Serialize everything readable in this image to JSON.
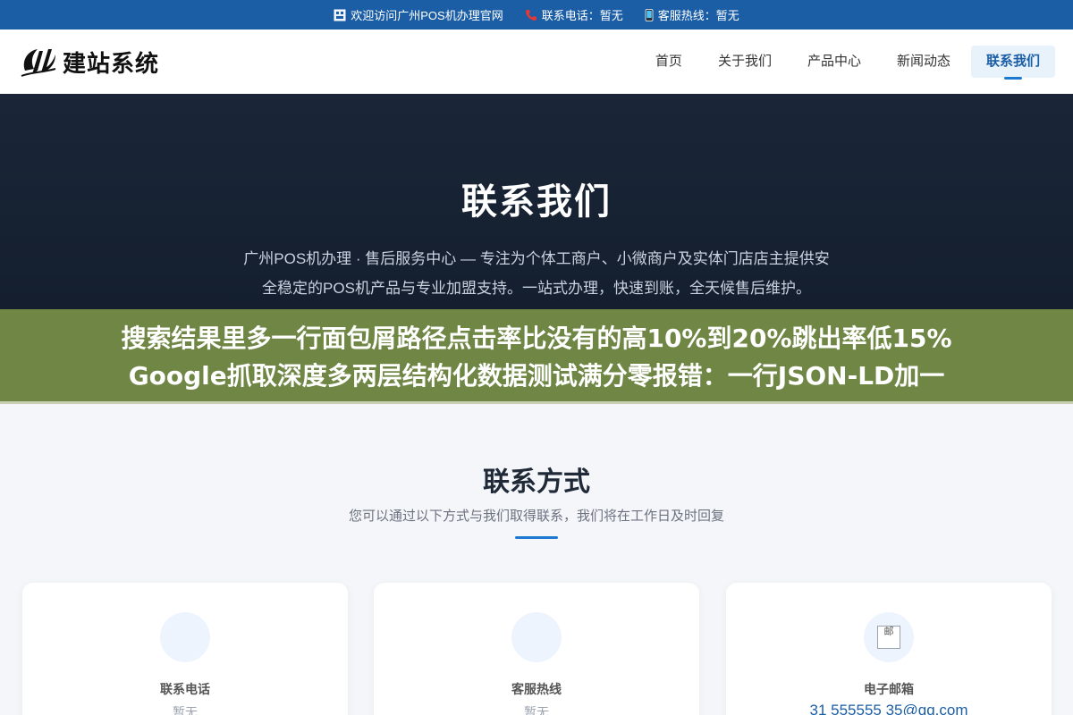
{
  "topbar": {
    "welcome": "欢迎访问广州POS机办理官网",
    "phone_label": "联系电话：暂无",
    "hotline_label": "客服热线：暂无"
  },
  "header": {
    "logo_text": "建站系统",
    "nav": [
      "首页",
      "关于我们",
      "产品中心",
      "新闻动态",
      "联系我们"
    ],
    "active_nav": "联系我们"
  },
  "hero": {
    "title": "联系我们",
    "description": "广州POS机办理 · 售后服务中心 — 专注为个体工商户、小微商户及实体门店店主提供安全稳定的POS机产品与专业加盟支持。一站式办理，快速到账，全天候售后维护。"
  },
  "banner": {
    "line1": "搜索结果里多一行面包屑路径点击率比没有的高10%到20%跳出率低15%",
    "line2": "Google抓取深度多两层结构化数据测试满分零报错：一行JSON-LD加一"
  },
  "contact": {
    "title": "联系方式",
    "subtitle": "您可以通过以下方式与我们取得联系，我们将在工作日及时回复",
    "cards": [
      {
        "title": "联系电话",
        "value": "暂无",
        "icon": "phone-icon"
      },
      {
        "title": "客服热线",
        "value": "暂无",
        "icon": "headset-icon"
      },
      {
        "title": "电子邮箱",
        "value": "31 555555 35@qq.com",
        "icon": "email-icon",
        "icon_alt": "邮"
      }
    ]
  },
  "colors": {
    "brand": "#1b5ea6",
    "hero_bg": "#1a2638",
    "banner_bg": "#6f8644"
  }
}
